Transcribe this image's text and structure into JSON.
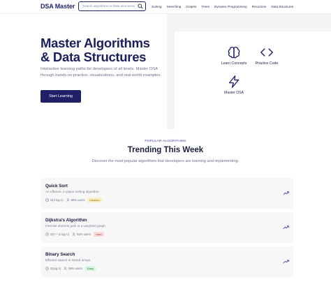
{
  "header": {
    "logo": "DSA Master",
    "search_placeholder": "Search algorithms or Data structures",
    "nav": [
      "Sorting",
      "Searching",
      "Graphs",
      "Trees",
      "Dynamic Programming",
      "Recursion",
      "Data Structures"
    ]
  },
  "hero": {
    "title_line1": "Master Algorithms",
    "title_line2": "& Data Structures",
    "description": "Interactive learning paths for developers of all levels. Master DSA through hands-on practice, visualizations, and real-world examples.",
    "cta_label": "Start Learning",
    "features": [
      {
        "label": "Learn Concepts",
        "icon": "brain-icon"
      },
      {
        "label": "Practice Code",
        "icon": "code-icon"
      },
      {
        "label": "Master DSA",
        "icon": "lightning-icon"
      }
    ]
  },
  "trending": {
    "kicker": "POPULAR ALGORITHMS",
    "title": "Trending This Week",
    "subtitle": "Discover the most popular algorithms that developers are learning and implementing.",
    "cards": [
      {
        "title": "Quick Sort",
        "description": "An efficient, in-place sorting algorithm",
        "complexity": "O(n log n)",
        "users": "85% users",
        "difficulty": "Medium"
      },
      {
        "title": "Dijkstra's Algorithm",
        "description": "Find the shortest path in a weighted graph",
        "complexity": "O(V + E log V)",
        "users": "92% users",
        "difficulty": "Hard"
      },
      {
        "title": "Binary Search",
        "description": "Efficient search in sorted arrays",
        "complexity": "O(log n)",
        "users": "98% users",
        "difficulty": "Easy"
      }
    ]
  },
  "colors": {
    "brand": "#1c1f6b",
    "cta": "#1e2166",
    "accent": "#3d4592"
  }
}
